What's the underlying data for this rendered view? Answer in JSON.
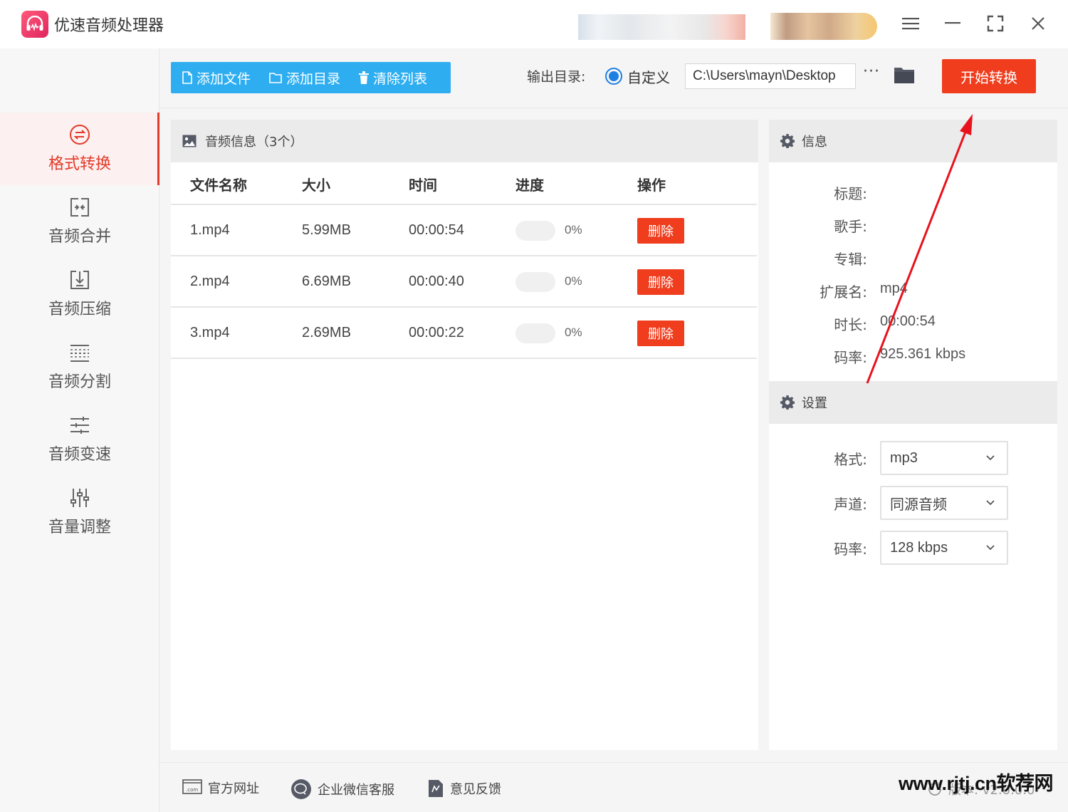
{
  "app": {
    "title": "优速音频处理器"
  },
  "window_controls": {
    "menu": "menu-icon",
    "minimize": "minimize-icon",
    "maximize": "maximize-icon",
    "close": "close-icon"
  },
  "sidebar": {
    "items": [
      {
        "label": "格式转换",
        "icon": "format-convert-icon",
        "active": true
      },
      {
        "label": "音频合并",
        "icon": "merge-icon",
        "active": false
      },
      {
        "label": "音频压缩",
        "icon": "compress-icon",
        "active": false
      },
      {
        "label": "音频分割",
        "icon": "split-icon",
        "active": false
      },
      {
        "label": "音频变速",
        "icon": "speed-icon",
        "active": false
      },
      {
        "label": "音量调整",
        "icon": "volume-icon",
        "active": false
      }
    ]
  },
  "toolbar": {
    "add_file": "添加文件",
    "add_folder": "添加目录",
    "clear_list": "清除列表",
    "output_label": "输出目录:",
    "custom_label": "自定义",
    "output_path": "C:\\Users\\mayn\\Desktop",
    "more": "···",
    "start": "开始转换"
  },
  "file_list": {
    "title": "音频信息（3个）",
    "columns": {
      "name": "文件名称",
      "size": "大小",
      "time": "时间",
      "progress": "进度",
      "action": "操作"
    },
    "rows": [
      {
        "name": "1.mp4",
        "size": "5.99MB",
        "time": "00:00:54",
        "progress": 0,
        "progress_text": "0%",
        "action": "删除"
      },
      {
        "name": "2.mp4",
        "size": "6.69MB",
        "time": "00:00:40",
        "progress": 0,
        "progress_text": "0%",
        "action": "删除"
      },
      {
        "name": "3.mp4",
        "size": "2.69MB",
        "time": "00:00:22",
        "progress": 0,
        "progress_text": "0%",
        "action": "删除"
      }
    ]
  },
  "info": {
    "title": "信息",
    "fields": [
      {
        "label": "标题:",
        "value": ""
      },
      {
        "label": "歌手:",
        "value": ""
      },
      {
        "label": "专辑:",
        "value": ""
      },
      {
        "label": "扩展名:",
        "value": "mp4"
      },
      {
        "label": "时长:",
        "value": "00:00:54"
      },
      {
        "label": "码率:",
        "value": "925.361 kbps"
      }
    ]
  },
  "settings": {
    "title": "设置",
    "fields": [
      {
        "label": "格式:",
        "value": "mp3"
      },
      {
        "label": "声道:",
        "value": "同源音频"
      },
      {
        "label": "码率:",
        "value": "128 kbps"
      }
    ]
  },
  "footer": {
    "website": "官方网址",
    "wechat": "企业微信客服",
    "feedback": "意见反馈",
    "version": "版本: v2.0.0.0"
  },
  "watermark": "www.rjtj.cn软荐网",
  "colors": {
    "accent_red": "#ef3d1e",
    "toolbar_blue": "#2eaef0",
    "radio_blue": "#1e7fe3"
  }
}
